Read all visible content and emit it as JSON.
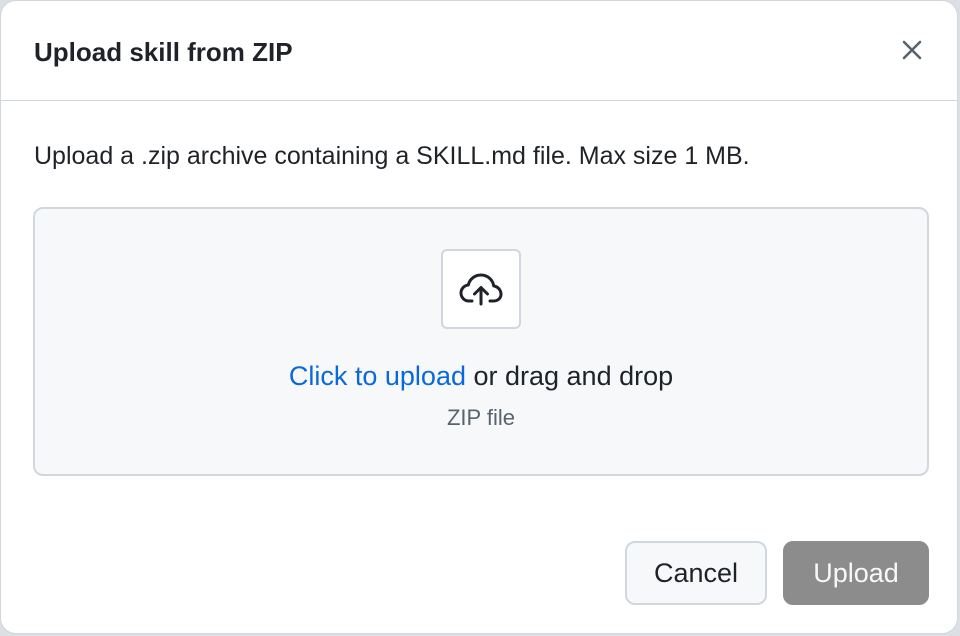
{
  "dialog": {
    "title": "Upload skill from ZIP",
    "close_icon": "close-icon",
    "description": "Upload a .zip archive containing a SKILL.md file. Max size 1 MB."
  },
  "dropzone": {
    "icon": "cloud-upload-icon",
    "link_text": "Click to upload",
    "rest_text": " or drag and drop",
    "hint": "ZIP file"
  },
  "footer": {
    "cancel_label": "Cancel",
    "upload_label": "Upload",
    "upload_disabled": true
  },
  "colors": {
    "link": "#0969da",
    "text": "#1f2328",
    "muted": "#59636e",
    "disabled_button": "#8c8c8c",
    "border": "#d0d7de"
  }
}
